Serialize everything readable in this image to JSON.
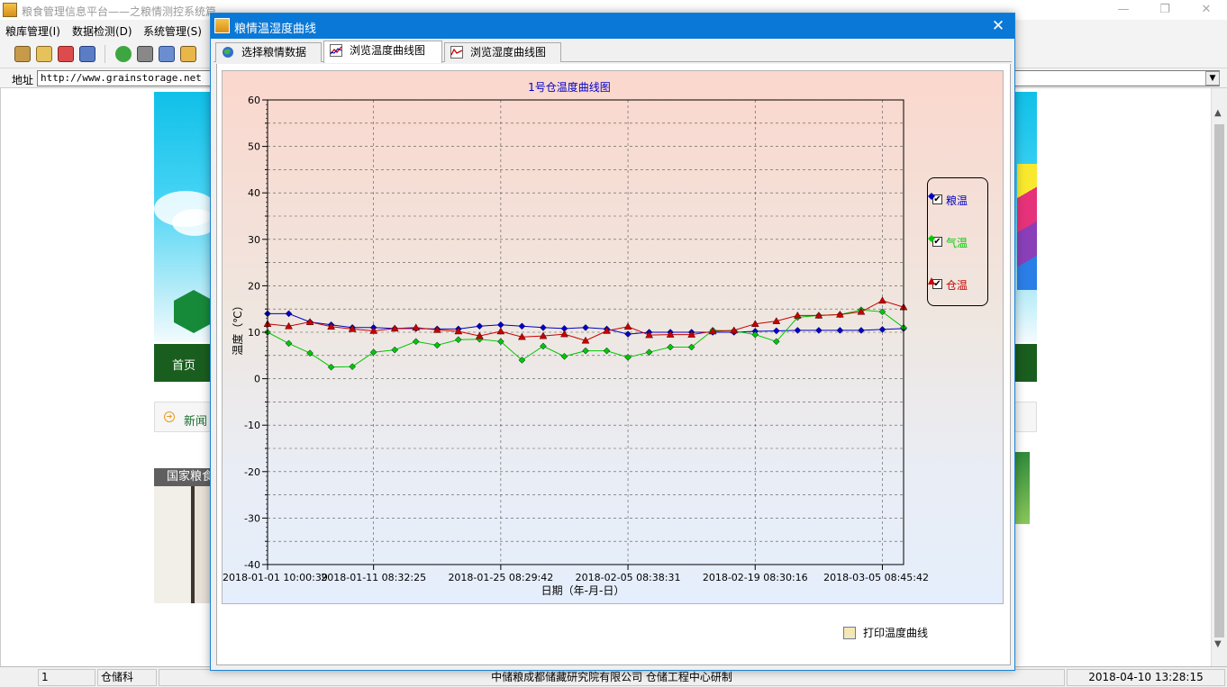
{
  "app": {
    "title": "粮食管理信息平台——之粮情测控系统篇",
    "minimize": "—",
    "maximize": "❐",
    "close": "✕"
  },
  "menu": {
    "items": [
      "粮库管理(I)",
      "数据检测(D)",
      "系统管理(S)"
    ]
  },
  "address": {
    "label": "地址",
    "url": "http://www.grainstorage.net"
  },
  "web": {
    "nav_home": "首页",
    "news_label": "新闻",
    "photo_caption": "国家粮食"
  },
  "statusbar": {
    "user_count": "1",
    "department": "仓储科",
    "org": "中储粮成都储藏研究院有限公司    仓储工程中心研制",
    "datetime": "2018-04-10   13:28:15"
  },
  "dialog": {
    "title": "粮情温湿度曲线",
    "close_glyph": "✕",
    "tabs": [
      {
        "label": "选择粮情数据",
        "icon": "globe-icon"
      },
      {
        "label": "浏览温度曲线图",
        "icon": "temperature-chart-icon"
      },
      {
        "label": "浏览湿度曲线图",
        "icon": "humidity-chart-icon"
      }
    ],
    "active_tab": 1,
    "print_label": "打印温度曲线"
  },
  "legend": {
    "items": [
      {
        "name": "粮温",
        "color": "#0000c8",
        "marker": "diamond",
        "checked": true
      },
      {
        "name": "气温",
        "color": "#00c800",
        "marker": "diamond",
        "checked": true
      },
      {
        "name": "仓温",
        "color": "#c80000",
        "marker": "triangle",
        "checked": true
      }
    ]
  },
  "chart_data": {
    "type": "line",
    "title": "1号仓温度曲线图",
    "xlabel": "日期（年-月-日）",
    "ylabel": "温度（℃）",
    "ylim": [
      -40,
      60
    ],
    "yticks": [
      60,
      50,
      40,
      30,
      20,
      10,
      0,
      -10,
      -20,
      -30,
      -40
    ],
    "grid": true,
    "legend_position": "right",
    "x_tick_labels": [
      "2018-01-01 10:00:39",
      "2018-01-11 08:32:25",
      "2018-01-25 08:29:42",
      "2018-02-05 08:38:31",
      "2018-02-19 08:30:16",
      "2018-03-05 08:45:42"
    ],
    "x_tick_index": [
      0,
      5,
      11,
      17,
      23,
      29
    ],
    "point_count": 31,
    "series": [
      {
        "name": "粮温",
        "color": "#0000c8",
        "marker": "diamond",
        "values": [
          14,
          14,
          12.2,
          11.6,
          11,
          11,
          10.8,
          10.8,
          10.7,
          10.7,
          11.3,
          11.6,
          11.3,
          11,
          10.8,
          11,
          10.7,
          9.6,
          10,
          10,
          10,
          10,
          10,
          10.2,
          10.3,
          10.4,
          10.4,
          10.4,
          10.4,
          10.6,
          10.8
        ]
      },
      {
        "name": "气温",
        "color": "#00c800",
        "marker": "diamond",
        "values": [
          10,
          7.6,
          5.5,
          2.5,
          2.6,
          5.7,
          6.2,
          8,
          7.2,
          8.4,
          8.5,
          8,
          4,
          7,
          4.8,
          6,
          6,
          4.6,
          5.7,
          6.8,
          6.8,
          10.4,
          10.3,
          9.5,
          8,
          13.2,
          13.6,
          13.8,
          14.8,
          14.4,
          11
        ]
      },
      {
        "name": "仓温",
        "color": "#c80000",
        "marker": "triangle",
        "values": [
          11.8,
          11.3,
          12.2,
          11.2,
          10.7,
          10.3,
          10.8,
          11,
          10.5,
          10.2,
          9.2,
          10.2,
          9,
          9.2,
          9.6,
          8.2,
          10.3,
          11.2,
          9.4,
          9.5,
          9.5,
          10.2,
          10.4,
          11.8,
          12.4,
          13.6,
          13.6,
          13.8,
          14.4,
          16.8,
          15.4
        ]
      }
    ]
  }
}
